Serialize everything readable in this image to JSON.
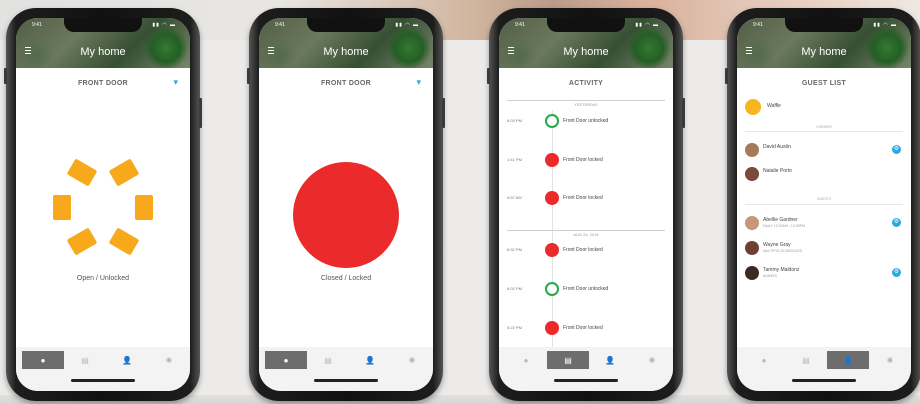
{
  "app_title": "My home",
  "phones": [
    {
      "section_title": "FRONT DOOR",
      "caption": "Open / Unlocked"
    },
    {
      "section_title": "FRONT DOOR",
      "caption": "Closed / Locked"
    },
    {
      "section_title": "ACTIVITY"
    },
    {
      "section_title": "GUEST LIST"
    }
  ],
  "activity": {
    "days": [
      "YESTERDAY",
      "AUG 24, 2016"
    ],
    "events": [
      {
        "time": "6:03 PM",
        "text": "Front Door unlocked",
        "status": "unlocked"
      },
      {
        "time": "1:41 PM",
        "text": "Front Door locked",
        "status": "locked"
      },
      {
        "time": "9:57 AM",
        "text": "Front Door locked",
        "status": "locked"
      },
      {
        "time": "8:32 PM",
        "text": "Front Door locked",
        "status": "locked"
      },
      {
        "time": "6:02 PM",
        "text": "Front Door unlocked",
        "status": "unlocked"
      },
      {
        "time": "5:22 PM",
        "text": "Front Door locked",
        "status": "locked"
      }
    ]
  },
  "guests": {
    "owner": "Waffle",
    "owner_section": "OWNERS",
    "owners": [
      "David Austin",
      "Natalie Porto"
    ],
    "guest_section": "GUESTS",
    "guest_list": [
      {
        "name": "Abellie Gardner",
        "sub": "DAILY 12:30AM - 12:30PM"
      },
      {
        "name": "Wayne Gray",
        "sub": "MULTIPLE SCHEDULES"
      },
      {
        "name": "Tammy Maldonz",
        "sub": "ALWAYS"
      }
    ]
  },
  "icons": {
    "wifi": "wifi-icon",
    "menu": "hamburger-icon",
    "tabs": [
      "home-icon",
      "history-icon",
      "guests-icon",
      "settings-icon"
    ]
  },
  "colors": {
    "unlocked_orange": "#f7a81b",
    "locked_red": "#eb2b2b",
    "unlocked_green": "#24a84a",
    "accent_blue": "#29a9e0"
  }
}
